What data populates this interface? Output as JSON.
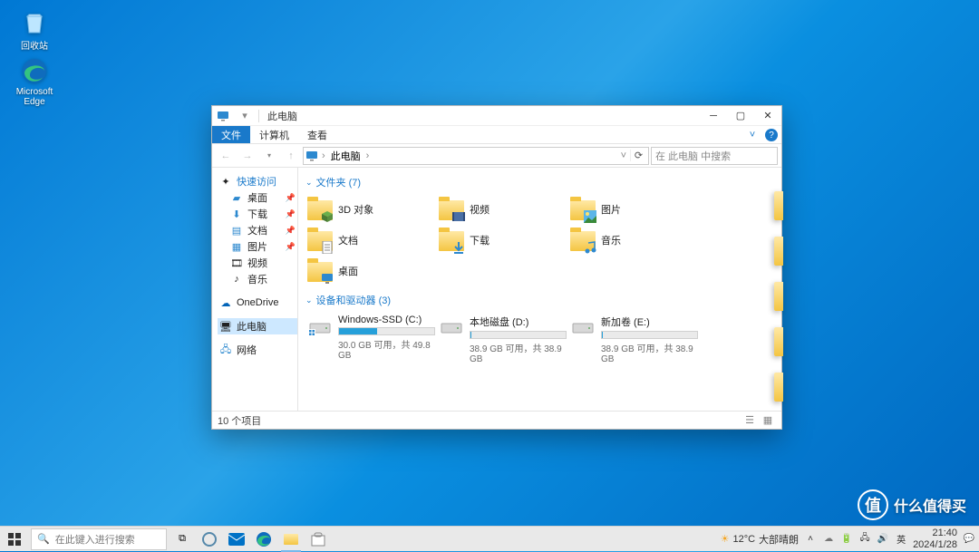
{
  "desktop": {
    "recycle_bin": "回收站",
    "edge": "Microsoft Edge"
  },
  "window": {
    "title": "此电脑",
    "tabs": {
      "file": "文件",
      "computer": "计算机",
      "view": "查看"
    },
    "breadcrumb": "此电脑",
    "search_placeholder": "在 此电脑 中搜索",
    "nav": {
      "quick_access": "快速访问",
      "desktop": "桌面",
      "downloads": "下载",
      "documents": "文档",
      "pictures": "图片",
      "videos": "视频",
      "music": "音乐",
      "onedrive": "OneDrive",
      "this_pc": "此电脑",
      "network": "网络"
    },
    "groups": {
      "folders": {
        "title": "文件夹 (7)",
        "items": [
          {
            "label": "3D 对象",
            "overlay": "cube"
          },
          {
            "label": "视频",
            "overlay": "film"
          },
          {
            "label": "图片",
            "overlay": "image"
          },
          {
            "label": "文档",
            "overlay": "doc"
          },
          {
            "label": "下载",
            "overlay": "down"
          },
          {
            "label": "音乐",
            "overlay": "music"
          },
          {
            "label": "桌面",
            "overlay": "desk"
          }
        ]
      },
      "drives": {
        "title": "设备和驱动器 (3)",
        "items": [
          {
            "name": "Windows-SSD (C:)",
            "detail": "30.0 GB 可用，共 49.8 GB",
            "used_pct": 40,
            "os": true
          },
          {
            "name": "本地磁盘 (D:)",
            "detail": "38.9 GB 可用，共 38.9 GB",
            "used_pct": 1
          },
          {
            "name": "新加卷 (E:)",
            "detail": "38.9 GB 可用，共 38.9 GB",
            "used_pct": 1
          }
        ]
      }
    },
    "status": "10 个项目"
  },
  "taskbar": {
    "search_placeholder": "在此键入进行搜索",
    "weather": {
      "temp": "12°C",
      "desc": "大部晴朗"
    },
    "ime": "英",
    "time": "21:40",
    "date": "2024/1/28"
  },
  "watermark": "什么值得买"
}
